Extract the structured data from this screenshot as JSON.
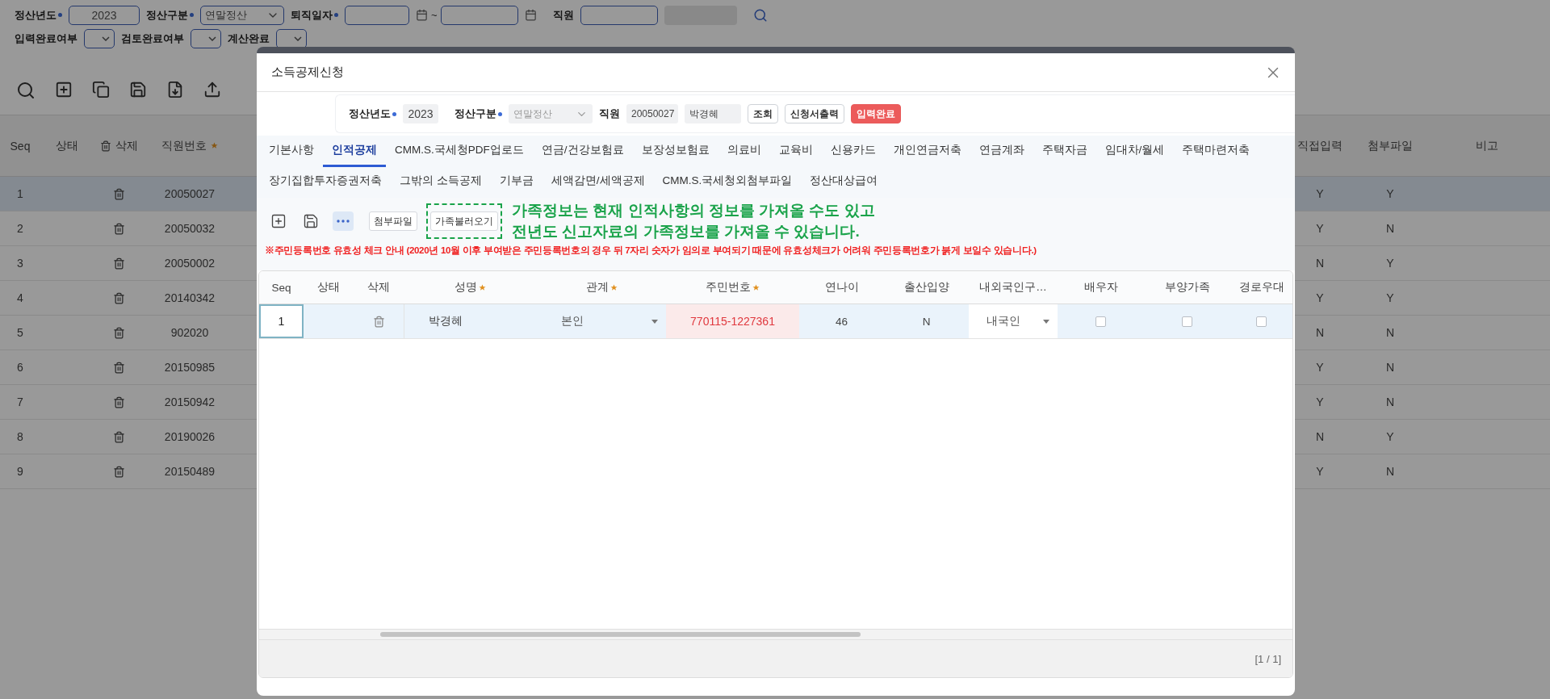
{
  "background": {
    "filter_row_1": [
      {
        "kind": "field",
        "label": "정산년도",
        "required": true,
        "value": "2023"
      },
      {
        "kind": "select",
        "label": "정산구분",
        "required": true,
        "value": "연말정산"
      },
      {
        "kind": "date_range",
        "label": "퇴직일자",
        "required": true,
        "separator": "~"
      },
      {
        "kind": "employee",
        "label": "직원"
      }
    ],
    "filter_row_2": [
      {
        "label": "입력완료여부"
      },
      {
        "label": "검토완료여부"
      },
      {
        "label": "계산완료"
      }
    ],
    "left_columns": [
      {
        "kind": "text",
        "label": "Seq"
      },
      {
        "kind": "text",
        "label": "상태"
      },
      {
        "kind": "delete",
        "label": "삭제"
      },
      {
        "kind": "required",
        "label": "직원번호"
      }
    ],
    "right_columns": [
      {
        "label": "직접입력"
      },
      {
        "label": "첨부파일"
      },
      {
        "label": "비고"
      }
    ],
    "rows": [
      {
        "seq": "1",
        "emp_no": "20050027",
        "direct_input": "Y",
        "attachment": "Y",
        "selected": true
      },
      {
        "seq": "2",
        "emp_no": "20050032",
        "direct_input": "Y",
        "attachment": "N",
        "selected": false
      },
      {
        "seq": "3",
        "emp_no": "20050002",
        "direct_input": "N",
        "attachment": "Y",
        "selected": false
      },
      {
        "seq": "4",
        "emp_no": "20140342",
        "direct_input": "Y",
        "attachment": "Y",
        "selected": false
      },
      {
        "seq": "5",
        "emp_no": "902020",
        "direct_input": "N",
        "attachment": "N",
        "selected": false
      },
      {
        "seq": "6",
        "emp_no": "20150985",
        "direct_input": "Y",
        "attachment": "N",
        "selected": false
      },
      {
        "seq": "7",
        "emp_no": "20150942",
        "direct_input": "Y",
        "attachment": "N",
        "selected": false
      },
      {
        "seq": "8",
        "emp_no": "20190026",
        "direct_input": "N",
        "attachment": "Y",
        "selected": false
      },
      {
        "seq": "9",
        "emp_no": "20150489",
        "direct_input": "Y",
        "attachment": "N",
        "selected": false
      }
    ]
  },
  "dialog": {
    "title": "소득공제신청",
    "year": {
      "label": "정산년도",
      "required": true,
      "value": "2023"
    },
    "settlement_type": {
      "label": "정산구분",
      "required": true,
      "value": "연말정산",
      "disabled": true
    },
    "employee": {
      "label": "직원",
      "id": "20050027",
      "name": "박경혜"
    },
    "buttons": [
      {
        "kind": "default",
        "label": "조회"
      },
      {
        "kind": "default",
        "label": "신청서출력"
      },
      {
        "kind": "danger",
        "label": "입력완료"
      }
    ],
    "tab_rows": [
      [
        {
          "label": "기본사항",
          "selected": false
        },
        {
          "label": "인적공제",
          "selected": true
        },
        {
          "label": "CMM.S.국세청PDF업로드",
          "selected": false
        },
        {
          "label": "연금/건강보험료",
          "selected": false
        },
        {
          "label": "보장성보험료",
          "selected": false
        },
        {
          "label": "의료비",
          "selected": false
        },
        {
          "label": "교육비",
          "selected": false
        },
        {
          "label": "신용카드",
          "selected": false
        },
        {
          "label": "개인연금저축",
          "selected": false
        },
        {
          "label": "연금계좌",
          "selected": false
        },
        {
          "label": "주택자금",
          "selected": false
        },
        {
          "label": "임대차/월세",
          "selected": false
        },
        {
          "label": "주택마련저축",
          "selected": false
        }
      ],
      [
        {
          "label": "장기집합투자증권저축",
          "selected": false
        },
        {
          "label": "그밖의 소득공제",
          "selected": false
        },
        {
          "label": "기부금",
          "selected": false
        },
        {
          "label": "세액감면/세액공제",
          "selected": false
        },
        {
          "label": "CMM.S.국세청외첨부파일",
          "selected": false
        },
        {
          "label": "정산대상급여",
          "selected": false
        }
      ]
    ],
    "toolbar_buttons": [
      {
        "label": "첨부파일",
        "highlighted": false
      },
      {
        "label": "가족불러오기",
        "highlighted": true
      }
    ],
    "annotation": [
      "가족정보는 현재 인적사항의 정보를 가져올 수도 있고",
      "전년도 신고자료의 가족정보를 가져올 수 있습니다."
    ],
    "notice": "※주민등록번호 유효성 체크 안내 (2020년 10월 이후 부여받은 주민등록번호의 경우 뒤 7자리 숫자가 임의로 부여되기 때문에 유효성체크가 어려워 주민등록번호가 붉게 보일수 있습니다.)",
    "columns": [
      {
        "label": "Seq",
        "required": false
      },
      {
        "label": "상태",
        "required": false
      },
      {
        "label": "삭제",
        "required": false
      },
      {
        "label": "성명",
        "required": true
      },
      {
        "label": "관계",
        "required": true
      },
      {
        "label": "주민번호",
        "required": true
      },
      {
        "label": "연나이",
        "required": false
      },
      {
        "label": "출산입양",
        "required": false
      },
      {
        "label": "내외국인구…",
        "required": false
      },
      {
        "label": "배우자",
        "required": false
      },
      {
        "label": "부양가족",
        "required": false
      },
      {
        "label": "경로우대",
        "required": false
      }
    ],
    "rows": [
      {
        "seq": "1",
        "name": "박경혜",
        "relation": "본인",
        "rrn": "770115-1227361",
        "rrn_invalid": true,
        "age": "46",
        "birth_adoption": "N",
        "nationality": "내국인",
        "spouse": false,
        "dependent": false,
        "elderly": false,
        "selected": true
      }
    ],
    "pager": "[1 / 1]"
  }
}
